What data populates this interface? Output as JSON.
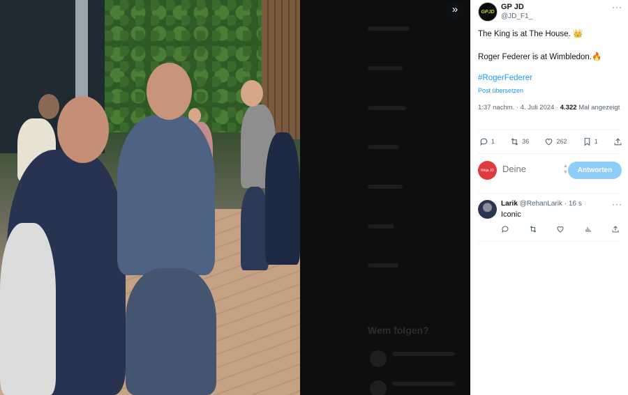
{
  "media": {
    "expand_icon": "double-chevron-right-icon",
    "ghost_title": "Wem folgen?"
  },
  "tweet": {
    "author_name": "GP JD",
    "author_handle": "@JD_F1_",
    "avatar_text": "GPJD",
    "line1": "The King is at The House. 👑",
    "line2": "Roger Federer is at Wimbledon.🔥",
    "hashtag": "#RogerFederer",
    "translate": "Post übersetzen",
    "time": "1:37 nachm. · 4. Juli 2024 ·",
    "views": "4.322",
    "views_label": "Mal angezeigt",
    "more_icon": "···"
  },
  "actions": {
    "replies": "1",
    "reposts": "36",
    "likes": "262",
    "bookmarks": "1"
  },
  "reply_box": {
    "placeholder": "Deine",
    "avatar_text": "Ninja JD",
    "button": "Antworten"
  },
  "reply": {
    "name": "Larik",
    "handle": "@RehanLarik · 16 s",
    "text": "Iconic",
    "more_icon": "···"
  },
  "colors": {
    "accent": "#1d9bf0",
    "reply_button": "#8ecdf8",
    "text_secondary": "#536471"
  }
}
